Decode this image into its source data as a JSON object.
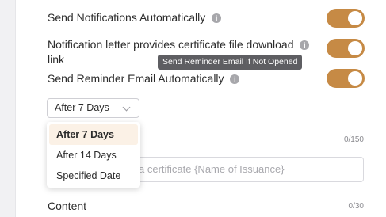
{
  "settings": {
    "send_notifications": {
      "label": "Send Notifications Automatically",
      "info": "i",
      "on": true
    },
    "certificate_download": {
      "label_line1": "Notification letter provides certificate file download",
      "label_line2": "link",
      "info": "i",
      "on": true
    },
    "send_reminder": {
      "label": "Send Reminder Email Automatically",
      "info": "i",
      "on": true
    }
  },
  "tooltip": {
    "text": "Send Reminder Email If Not Opened"
  },
  "reminder_select": {
    "value": "After 7 Days",
    "options": [
      "After 7 Days",
      "After 14 Days",
      "Specified Date"
    ],
    "selected_index": 0
  },
  "subject": {
    "counter": "0/150",
    "placeholder": "a certificate {Name of Issuance}"
  },
  "content": {
    "title": "Content",
    "counter": "0/30"
  },
  "colors": {
    "accent": "#c68a45",
    "tooltip_bg": "#5e5e62",
    "selected_bg": "#fbf1e6"
  }
}
